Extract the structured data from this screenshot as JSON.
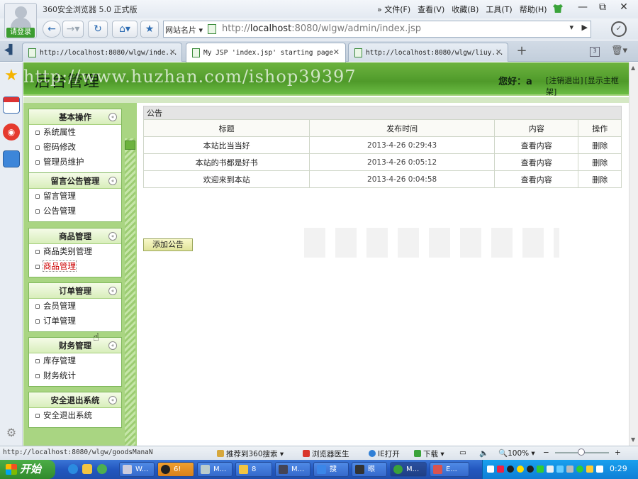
{
  "browser": {
    "title": "360安全浏览器 5.0 正式版",
    "login_label": "请登录",
    "menu": [
      "» 文件(F)",
      "查看(V)",
      "收藏(B)",
      "工具(T)",
      "帮助(H)"
    ],
    "win_min": "—",
    "win_max": "⧉",
    "win_close": "✕"
  },
  "address_bar": {
    "site_cards_label": "网站名片 ▾",
    "url_prefix": "http://",
    "url_host": "localhost",
    "url_rest": ":8080/wlgw/admin/index.jsp",
    "dropdown": "▾",
    "go": "▶"
  },
  "tabs": [
    {
      "label": "http://localhost:8080/wlgw/inde...",
      "active": false
    },
    {
      "label": "My JSP 'index.jsp' starting page",
      "active": true
    },
    {
      "label": "http://localhost:8080/wlgw/liuy...",
      "active": false
    }
  ],
  "page": {
    "header_title": "后台管理",
    "watermark": "http://www.huzhan.com/ishop39397",
    "greeting_prefix": "您好：",
    "username": "a",
    "logout_link": "[注销退出]",
    "show_frame_link": "[显示主框架]"
  },
  "sidebar": {
    "groups": [
      {
        "title": "基本操作",
        "items": [
          "系统属性",
          "密码修改",
          "管理员维护"
        ]
      },
      {
        "title": "留言公告管理",
        "items": [
          "留言管理",
          "公告管理"
        ]
      },
      {
        "title": "商品管理",
        "items": [
          "商品类别管理",
          "商品管理"
        ]
      },
      {
        "title": "订单管理",
        "items": [
          "会员管理",
          "订单管理"
        ]
      },
      {
        "title": "财务管理",
        "items": [
          "库存管理",
          "财务统计"
        ]
      },
      {
        "title": "安全退出系统",
        "items": [
          "安全退出系统"
        ]
      }
    ],
    "collapse_symbol": "«",
    "hover_item": "商品管理"
  },
  "announcements": {
    "panel_title": "公告",
    "columns": [
      "标题",
      "发布时间",
      "内容",
      "操作"
    ],
    "rows": [
      {
        "title": "本站比当当好",
        "time": "2013-4-26 0:29:43",
        "content": "查看内容",
        "action": "删除"
      },
      {
        "title": "本站的书都是好书",
        "time": "2013-4-26 0:05:12",
        "content": "查看内容",
        "action": "删除"
      },
      {
        "title": "欢迎来到本站",
        "time": "2013-4-26 0:04:58",
        "content": "查看内容",
        "action": "删除"
      }
    ],
    "add_button": "添加公告"
  },
  "statusbar": {
    "url": "http://localhost:8080/wlgw/goodsManaN",
    "recommend": "推荐到360搜索 ▾",
    "doctor": "浏览器医生",
    "ie_open": "IE打开",
    "download": "下载 ▾",
    "zoom": "100% ▾",
    "zoom_minus": "−",
    "zoom_plus": "+"
  },
  "taskbar": {
    "start_label": "开始",
    "tasks": [
      "W...",
      "6!",
      "M...",
      "8",
      "M...",
      "搜",
      "眼",
      "M...",
      "E..."
    ],
    "clock": "0:29"
  },
  "colors": {
    "header_green": "#4f9a2a",
    "sidebar_green": "#a9d582",
    "taskbar_blue": "#2357bf",
    "hover_red": "#cc0000"
  }
}
